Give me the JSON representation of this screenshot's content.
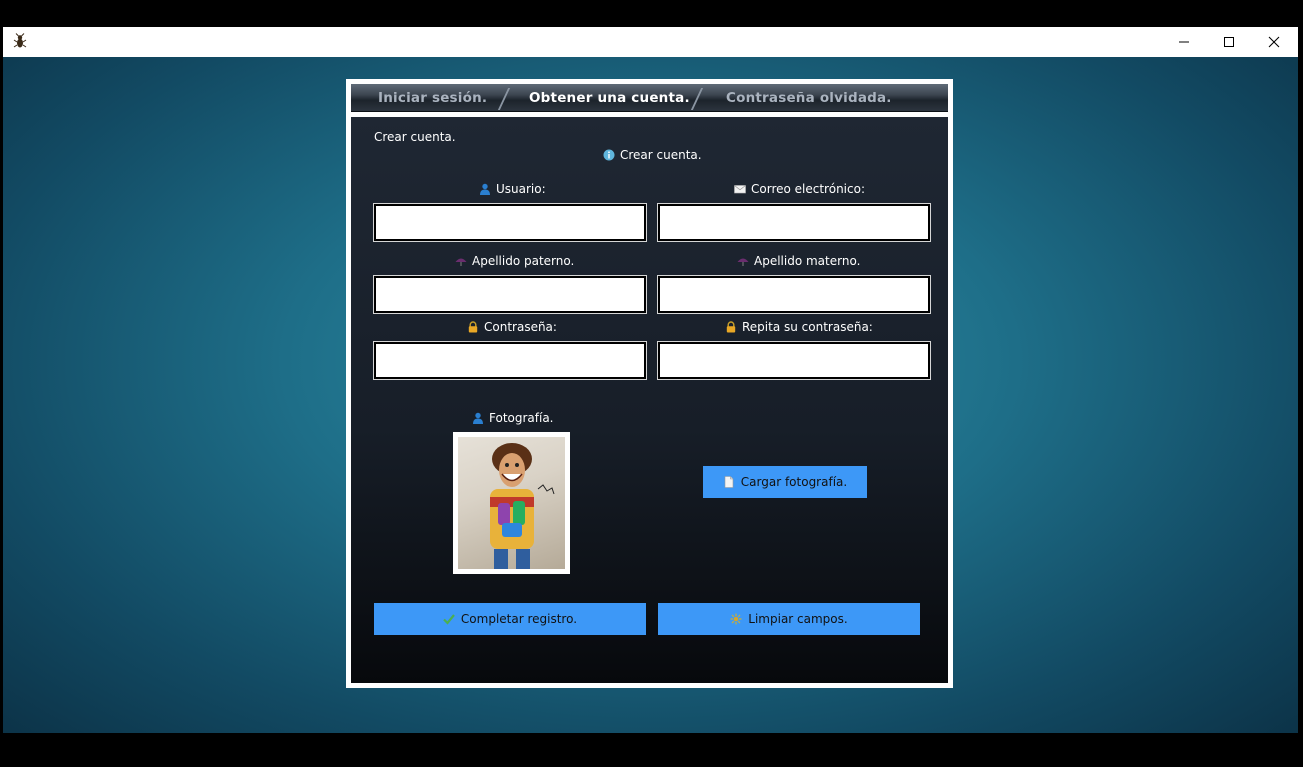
{
  "window": {
    "app_icon": "bug-icon",
    "controls": [
      "minimize-icon",
      "maximize-icon",
      "close-icon"
    ]
  },
  "tabs": [
    {
      "label": "Iniciar sesión.",
      "active": false
    },
    {
      "label": "Obtener una cuenta.",
      "active": true
    },
    {
      "label": "Contraseña olvidada.",
      "active": false
    }
  ],
  "form": {
    "section_title": "Crear cuenta.",
    "info_title": "Crear cuenta.",
    "fields": {
      "usuario": {
        "label": "Usuario:",
        "value": "",
        "icon": "user-icon"
      },
      "correo": {
        "label": "Correo electrónico:",
        "value": "",
        "icon": "envelope-icon"
      },
      "apellido_paterno": {
        "label": "Apellido paterno.",
        "value": "",
        "icon": "umbrella-icon"
      },
      "apellido_materno": {
        "label": "Apellido materno.",
        "value": "",
        "icon": "umbrella-icon"
      },
      "contrasena": {
        "label": "Contraseña:",
        "value": "",
        "icon": "lock-icon"
      },
      "repita_contrasena": {
        "label": "Repita su contraseña:",
        "value": "",
        "icon": "lock-icon"
      }
    },
    "photo_label": "Fotografía.",
    "upload_label": "Cargar fotografía.",
    "submit_label": "Completar registro.",
    "clear_label": "Limpiar campos."
  },
  "colors": {
    "button": "#3d98f7",
    "panel_top": "#1f2733",
    "desktop": "#1e6e88"
  }
}
